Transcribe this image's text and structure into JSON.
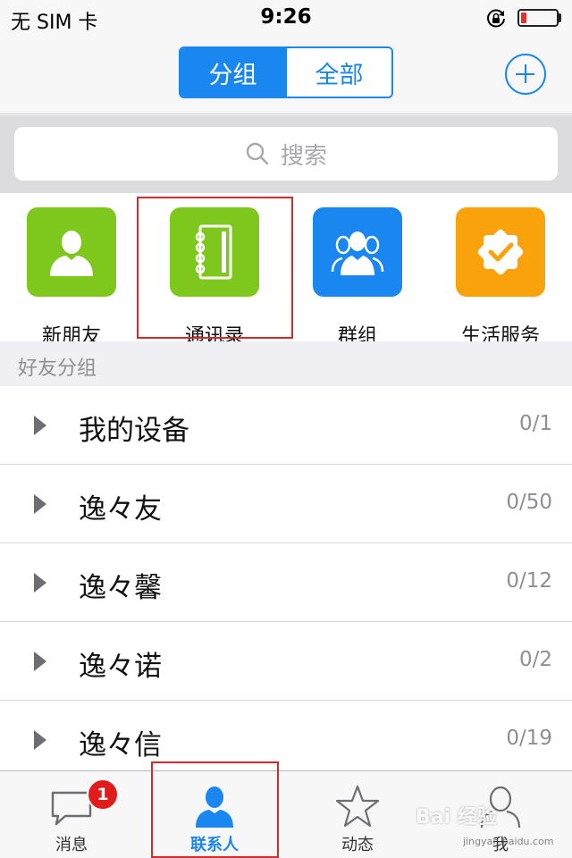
{
  "status_bar": {
    "carrier": "无 SIM 卡",
    "time": "9:26",
    "lock_icon": "rotation-lock-icon",
    "battery_icon": "battery-low-icon",
    "battery_color": "#e53030"
  },
  "nav": {
    "segments": [
      "分组",
      "全部"
    ],
    "active_segment": "分组",
    "add_icon": "plus-circle-icon",
    "accent_color": "#1a87f0"
  },
  "search": {
    "placeholder": "搜索",
    "icon": "search-icon"
  },
  "quick_tiles": [
    {
      "label": "新朋友",
      "icon": "person-icon",
      "color": "#7ec81d"
    },
    {
      "label": "通讯录",
      "icon": "address-book-icon",
      "color": "#7ec81d",
      "highlighted": true
    },
    {
      "label": "群组",
      "icon": "group-icon",
      "color": "#1a87f0"
    },
    {
      "label": "生活服务",
      "icon": "badge-check-icon",
      "color": "#f9a20b"
    }
  ],
  "friend_groups": {
    "title": "好友分组",
    "items": [
      {
        "name": "我的设备",
        "count": "0/1"
      },
      {
        "name": "逸々友",
        "count": "0/50"
      },
      {
        "name": "逸々馨",
        "count": "0/12"
      },
      {
        "name": "逸々诺",
        "count": "0/2"
      },
      {
        "name": "逸々信",
        "count": "0/19"
      }
    ]
  },
  "tab_bar": {
    "tabs": [
      {
        "label": "消息",
        "icon": "chat-bubble-icon",
        "badge": "1"
      },
      {
        "label": "联系人",
        "icon": "contact-person-icon",
        "active": true
      },
      {
        "label": "动态",
        "icon": "star-icon"
      },
      {
        "label": "我",
        "icon": "profile-icon"
      }
    ]
  },
  "watermark": {
    "text": "Bai 经验",
    "sub": "jingyan.baidu.com"
  }
}
